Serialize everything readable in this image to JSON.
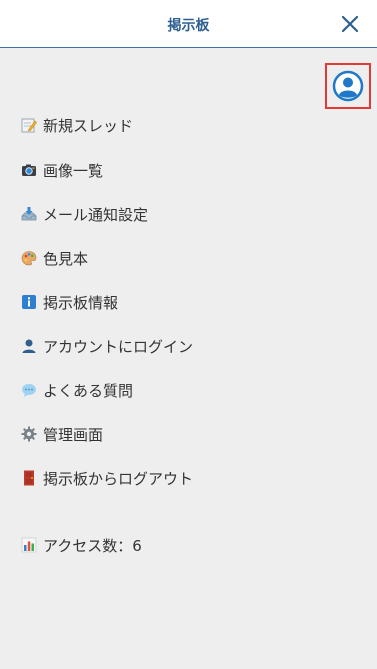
{
  "header": {
    "title": "掲示板"
  },
  "menu": {
    "items": [
      {
        "label": "新規スレッド",
        "icon": "memo-icon"
      },
      {
        "label": "画像一覧",
        "icon": "camera-icon"
      },
      {
        "label": "メール通知設定",
        "icon": "inbox-tray-icon"
      },
      {
        "label": "色見本",
        "icon": "palette-icon"
      },
      {
        "label": "掲示板情報",
        "icon": "info-icon"
      },
      {
        "label": "アカウントにログイン",
        "icon": "user-icon"
      },
      {
        "label": "よくある質問",
        "icon": "speech-bubble-icon"
      },
      {
        "label": "管理画面",
        "icon": "gear-icon"
      },
      {
        "label": "掲示板からログアウト",
        "icon": "door-icon"
      }
    ]
  },
  "footer": {
    "access_label": "アクセス数：6",
    "icon": "bar-chart-icon"
  },
  "colors": {
    "header_title": "#2d5f8f",
    "header_border": "#3d6fa0",
    "avatar_blue": "#1f78c8",
    "highlight_red": "#e53935",
    "panel_bg": "#eeeeee"
  }
}
